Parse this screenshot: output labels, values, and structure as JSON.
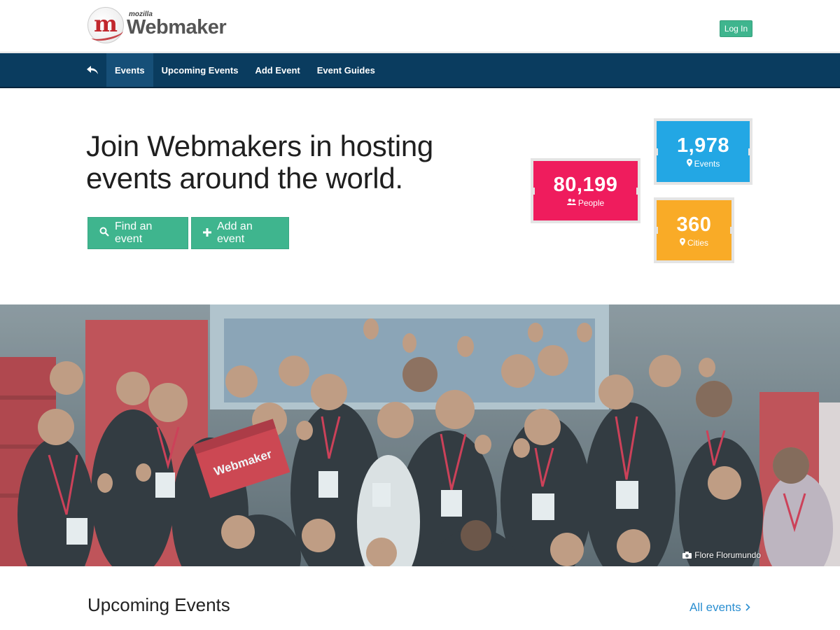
{
  "header": {
    "brand_small": "mozilla",
    "brand_name": "Webmaker",
    "logo_letter": "m",
    "login_label": "Log In"
  },
  "nav": {
    "back_icon": "back-arrow-icon",
    "items": [
      {
        "label": "Events",
        "active": true
      },
      {
        "label": "Upcoming Events",
        "active": false
      },
      {
        "label": "Add Event",
        "active": false
      },
      {
        "label": "Event Guides",
        "active": false
      }
    ]
  },
  "hero": {
    "title": "Join Webmakers in hosting events around the world.",
    "find_label": "Find an event",
    "add_label": "Add an event",
    "find_icon": "search-icon",
    "add_icon": "plus-icon"
  },
  "stats": {
    "people": {
      "value": "80,199",
      "label": "People",
      "color": "#ef1c5d",
      "icon": "users-icon"
    },
    "events": {
      "value": "1,978",
      "label": "Events",
      "color": "#23a7e4",
      "icon": "map-marker-icon"
    },
    "cities": {
      "value": "360",
      "label": "Cities",
      "color": "#f9ab27",
      "icon": "map-marker-icon"
    }
  },
  "photo": {
    "credit": "Flore Florumundo",
    "credit_icon": "camera-icon"
  },
  "upcoming": {
    "title": "Upcoming Events",
    "all_link": "All events"
  },
  "colors": {
    "accent_green": "#3fb58e",
    "nav_bg": "#0a3c5f",
    "nav_active": "#164f78",
    "link_blue": "#2b8fd1"
  }
}
